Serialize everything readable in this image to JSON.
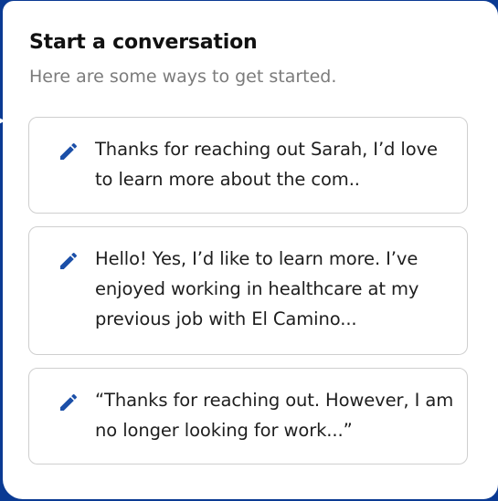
{
  "modal": {
    "title": "Start a conversation",
    "subtitle": "Here are some ways to get started."
  },
  "suggestions": [
    {
      "icon": "pencil-icon",
      "text": "Thanks for reaching out Sarah, I’d love to learn more about the com.."
    },
    {
      "icon": "pencil-icon",
      "text": "Hello! Yes, I’d like to learn more. I’ve enjoyed working in healthcare at my previous job with El Camino..."
    },
    {
      "icon": "pencil-icon",
      "text": "“Thanks for reaching out. However, I am no longer looking for work...”"
    }
  ],
  "colors": {
    "backdrop": "#0a3a93",
    "accent_icon": "#1b4fa8",
    "card_border": "#cfcfcf",
    "title_text": "#111111",
    "subtitle_text": "#7b7b7b"
  }
}
